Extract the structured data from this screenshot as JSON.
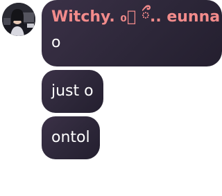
{
  "chat": {
    "sender_name": "Witchy. ₀⃘ ྀ.. eunna",
    "avatar_icon": "user-avatar",
    "messages": [
      {
        "text": "o"
      },
      {
        "text": "just o"
      },
      {
        "text": "ontol"
      }
    ]
  },
  "colors": {
    "bubble_bg": "#2d2739",
    "sender_name": "#f28b8b",
    "message_text": "#ffffff"
  }
}
